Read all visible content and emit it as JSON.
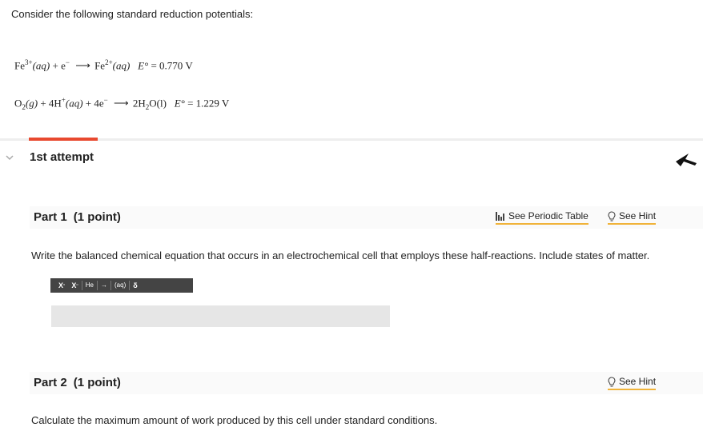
{
  "intro": "Consider the following standard reduction potentials:",
  "equations": {
    "eq1": {
      "reactant1": "Fe",
      "reactant1_charge": "3+",
      "reactant1_state": "(aq)",
      "plus": "+ e",
      "electron_charge": "−",
      "product": "Fe",
      "product_charge": "2+",
      "product_state": "(aq)",
      "potential_label": "E°",
      "potential_value": "= 0.770 V"
    },
    "eq2": {
      "reactant1": "O",
      "reactant1_sub": "2",
      "reactant1_state": "(g)",
      "reactant2": "+ 4H",
      "reactant2_charge": "+",
      "reactant2_state": "(aq)",
      "reactant3": "+ 4e",
      "reactant3_charge": "−",
      "product": "2H",
      "product_sub": "2",
      "product_tail": "O(l)",
      "potential_label": "E°",
      "potential_value": "= 1.229 V"
    }
  },
  "attempt": {
    "title": "1st attempt"
  },
  "part1": {
    "title": "Part 1",
    "points": "(1 point)",
    "periodic_table_link": "See Periodic Table",
    "hint_link": "See Hint",
    "question": "Write the balanced chemical equation that occurs in an electrochemical cell that employs these half-reactions. Include states of matter.",
    "toolbar": {
      "superscript": "X",
      "subscript": "X",
      "element": "He",
      "arrow": "→",
      "state": "(aq)",
      "delta": "δ"
    }
  },
  "part2": {
    "title": "Part 2",
    "points": "(1 point)",
    "hint_link": "See Hint",
    "question": "Calculate the maximum amount of work produced by this cell under standard conditions."
  },
  "colors": {
    "accent_red": "#e8492f",
    "link_underline": "#f0b33a",
    "toolbar_bg": "#444444"
  }
}
